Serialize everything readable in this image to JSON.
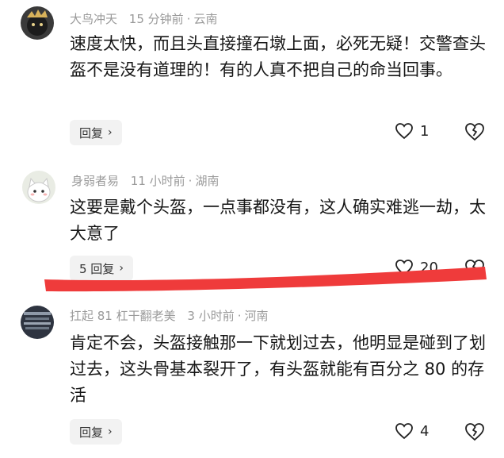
{
  "comments": [
    {
      "username": "大鸟冲天",
      "time": "15 分钟前",
      "location": "云南",
      "text": "速度太快，而且头直接撞石墩上面，必死无疑！交警查头盔不是没有道理的！有的人真不把自己的命当回事。",
      "reply_label": "回复",
      "likes": "1"
    },
    {
      "username": "身弱者易",
      "time": "11 小时前",
      "location": "湖南",
      "text": "这要是戴个头盔，一点事都没有，这人确实难逃一劫，太大意了",
      "reply_label": "5 回复",
      "likes": "20"
    },
    {
      "username": "扛起 81 杠干翻老美",
      "time": "3 小时前",
      "location": "河南",
      "text": "肯定不会，头盔接触那一下就划过去，他明显是碰到了划过去，这头骨基本裂开了，有头盔就能有百分之 80 的存活",
      "reply_label": "回复",
      "likes": "4"
    }
  ],
  "icons": {
    "like": "heart-outline-icon",
    "dislike": "broken-heart-icon",
    "reply_chevron": "chevron-right-icon"
  },
  "colors": {
    "annotation_stroke": "#ef3b3b",
    "meta_text": "#9a9a9a",
    "reply_bg": "#f2f2f2"
  }
}
